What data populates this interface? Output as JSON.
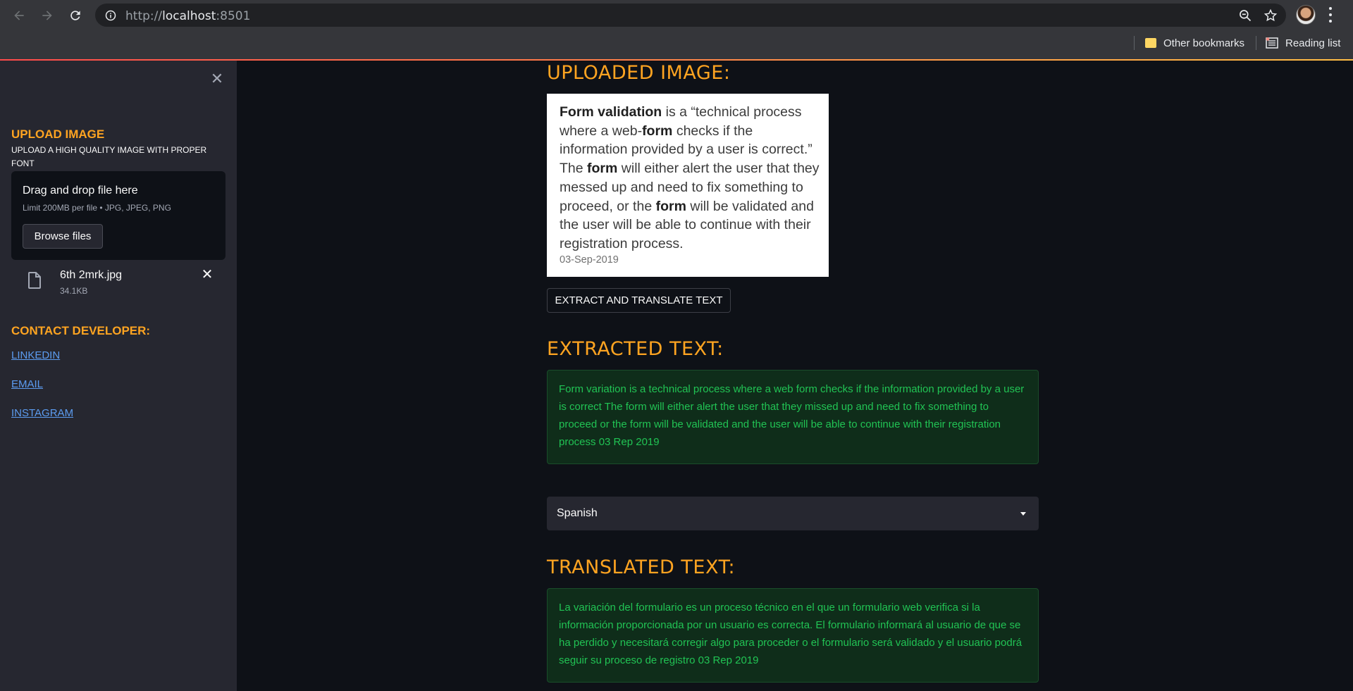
{
  "browser": {
    "url_prefix": "http://",
    "url_host": "localhost",
    "url_suffix": ":8501",
    "bookmarks": [
      "Other bookmarks",
      "Reading list"
    ]
  },
  "sidebar": {
    "upload_heading": "UPLOAD IMAGE",
    "upload_subtitle": "UPLOAD A HIGH QUALITY IMAGE WITH PROPER FONT",
    "dropzone_title": "Drag and drop file here",
    "dropzone_limit": "Limit 200MB per file • JPG, JPEG, PNG",
    "browse_label": "Browse files",
    "file_name": "6th 2mrk.jpg",
    "file_size": "34.1KB",
    "contact_heading": "CONTACT DEVELOPER:",
    "links": [
      "LINKEDIN",
      "EMAIL",
      "INSTAGRAM"
    ]
  },
  "main": {
    "uploaded_heading": "UPLOADED IMAGE:",
    "image_text": {
      "b1": "Form validation",
      "t1": " is a “technical process where a web-",
      "b2": "form",
      "t2": " checks if the information provided by a user is correct.” The ",
      "b3": "form",
      "t3": " will either alert the user that they messed up and need to fix something to proceed, or the ",
      "b4": "form",
      "t4": " will be validated and the user will be able to continue with their registration process.",
      "date": "03-Sep-2019"
    },
    "extract_button": "EXTRACT AND TRANSLATE TEXT",
    "extracted_heading": "EXTRACTED TEXT:",
    "extracted_text": "Form variation is a technical process where a web form checks if the information provided by a user is correct The form will either alert the user that they missed up and need to fix something to proceed or the form will be validated and the user will be able to continue with their registration process 03 Rep 2019",
    "language_selected": "Spanish",
    "translated_heading": "TRANSLATED TEXT:",
    "translated_text": "La variación del formulario es un proceso técnico en el que un formulario web verifica si la información proporcionada por un usuario es correcta. El formulario informará al usuario de que se ha perdido y necesitará corregir algo para proceder o el formulario será validado y el usuario podrá seguir su proceso de registro 03 Rep 2019"
  },
  "colors": {
    "accent": "#ffa421",
    "success_text": "#21c354",
    "app_bg": "#0e1117",
    "sidebar_bg": "#262730"
  }
}
